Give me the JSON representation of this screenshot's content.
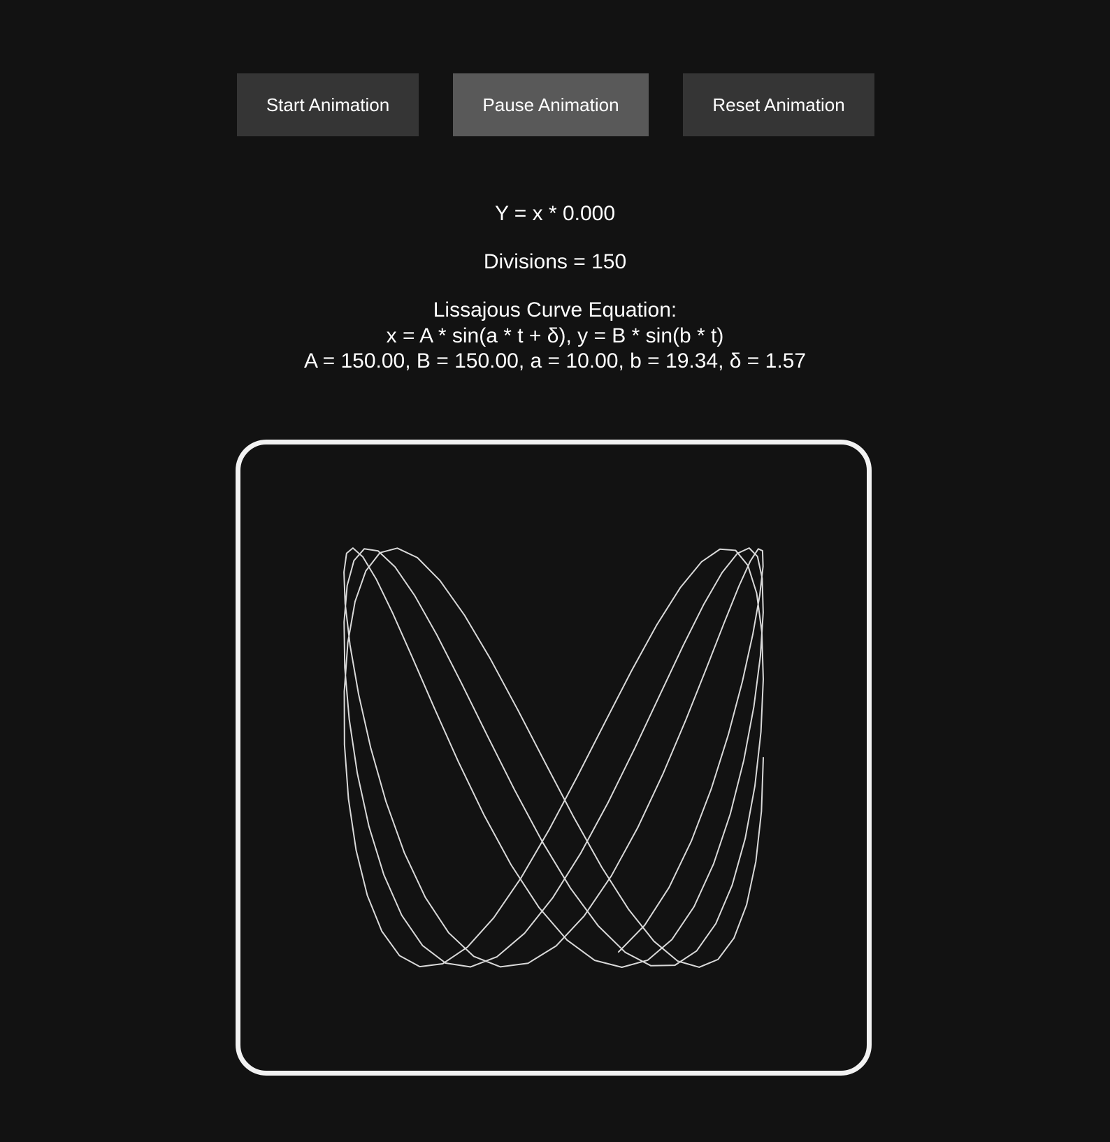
{
  "controls": {
    "start_label": "Start Animation",
    "pause_label": "Pause Animation",
    "reset_label": "Reset Animation"
  },
  "readouts": {
    "y_equation": "Y = x * 0.000",
    "divisions": "Divisions = 150"
  },
  "equation": {
    "title": "Lissajous Curve Equation:",
    "formula": "x = A * sin(a * t + δ), y = B * sin(b * t)",
    "params_text": "A = 150.00, B = 150.00, a = 10.00, b = 19.34, δ = 1.57"
  },
  "curve": {
    "A": 150,
    "B": 150,
    "a": 10,
    "b": 19.34,
    "delta": 1.57,
    "divisions": 150,
    "stroke_color": "#d9d9d9"
  },
  "colors": {
    "background": "#121212",
    "button": "#353535",
    "button_active": "#595959",
    "frame": "#f2f2f2",
    "text": "#ffffff"
  }
}
